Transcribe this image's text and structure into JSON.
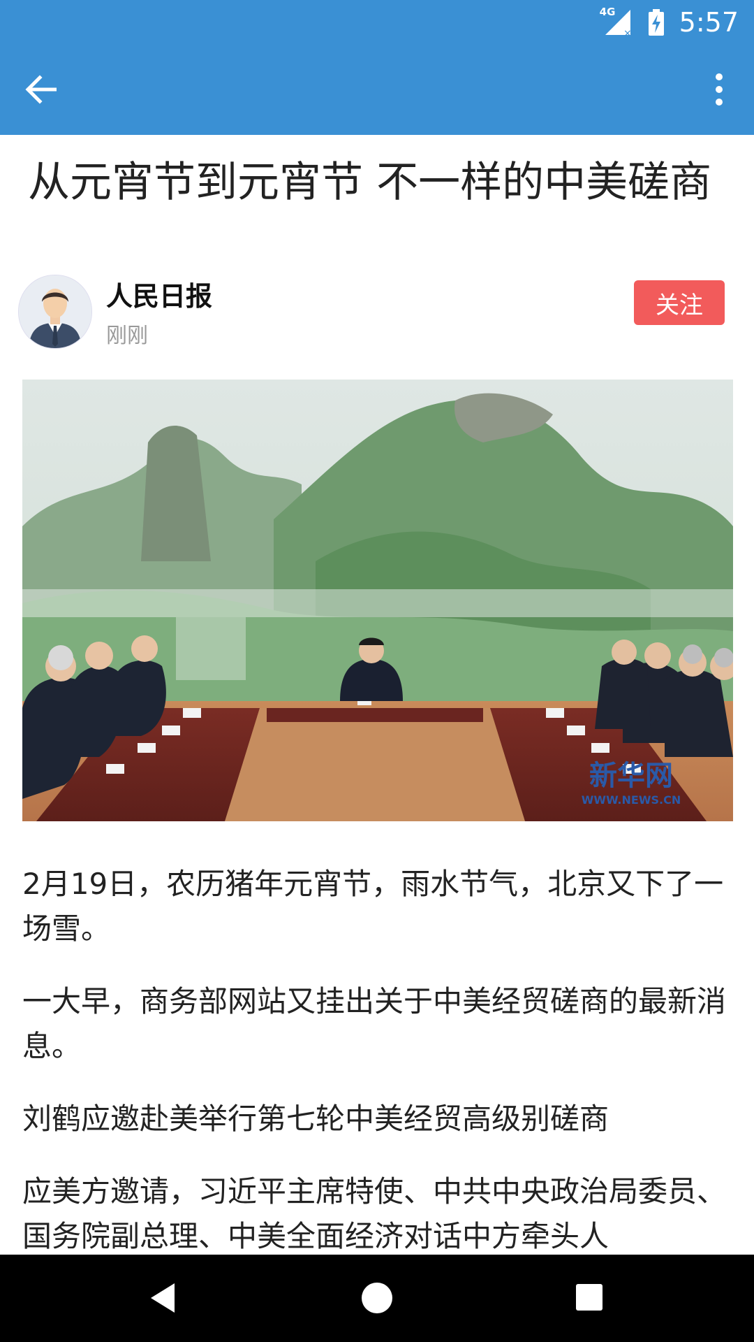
{
  "status_bar": {
    "time": "5:57",
    "network": "4G",
    "icons": [
      "signal-icon",
      "battery-charging-icon"
    ]
  },
  "app_bar": {
    "back_icon": "arrow-left-icon",
    "menu_icon": "more-vert-icon",
    "color": "#3a90d4"
  },
  "article": {
    "title": "从元宵节到元宵节 不一样的中美磋商",
    "author": {
      "name": "人民日报",
      "time": "刚刚",
      "follow_label": "关注"
    },
    "image": {
      "watermark": "新华网",
      "watermark_url": "WWW.NEWS.CN"
    },
    "paragraphs": [
      "2月19日，农历猪年元宵节，雨水节气，北京又下了一场雪。",
      "一大早，商务部网站又挂出关于中美经贸磋商的最新消息。",
      "刘鹤应邀赴美举行第七轮中美经贸高级别磋商",
      "应美方邀请，习近平主席特使、中共中央政治局委员、国务院副总理、中美全面经济对话中方牵头人"
    ]
  },
  "nav_bar": {
    "icons": [
      "nav-back-icon",
      "nav-home-icon",
      "nav-recents-icon"
    ]
  },
  "colors": {
    "accent": "#3a90d4",
    "follow": "#f25b5b"
  }
}
